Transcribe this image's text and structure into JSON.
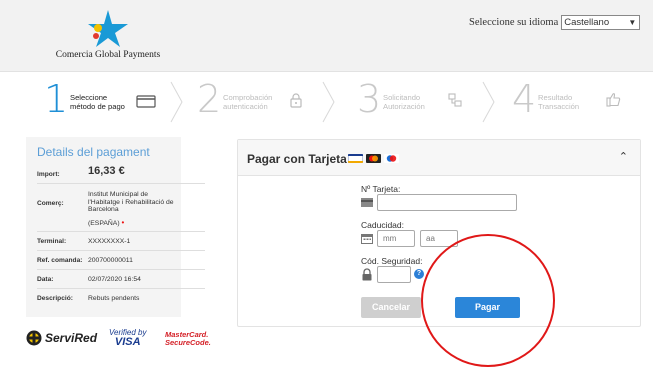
{
  "header": {
    "logo_text": "Comercia Global Payments",
    "language_label": "Seleccione su idioma",
    "language_value": "Castellano"
  },
  "steps": [
    {
      "number": "1",
      "line1": "Seleccione",
      "line2": "método de pago",
      "icon": "card-icon",
      "state": "active"
    },
    {
      "number": "2",
      "line1": "Comprobación",
      "line2": "autenticación",
      "icon": "lock-icon",
      "state": "inactive"
    },
    {
      "number": "3",
      "line1": "Solicitando",
      "line2": "Autorización",
      "icon": "network-icon",
      "state": "inactive"
    },
    {
      "number": "4",
      "line1": "Resultado",
      "line2": "Transacción",
      "icon": "thumbs-up-icon",
      "state": "inactive"
    }
  ],
  "details": {
    "title": "Details del pagament",
    "rows": [
      {
        "key": "Import:",
        "value": "16,33 €"
      },
      {
        "key": "Comerç:",
        "value": "Institut Municipal de l'Habitatge i Rehabilitació de Barcelona",
        "extra": "(ESPAÑA)"
      },
      {
        "key": "Terminal:",
        "value": "XXXXXXXX-1"
      },
      {
        "key": "Ref. comanda:",
        "value": "200700000011"
      },
      {
        "key": "Data:",
        "value": "02/07/2020  16:54"
      },
      {
        "key": "Descripció:",
        "value": "Rebuts pendents"
      }
    ]
  },
  "brands": {
    "servired": "ServiRed",
    "verified_1": "Verified by",
    "verified_2": "VISA",
    "mc_1": "MasterCard.",
    "mc_2": "SecureCode."
  },
  "payment": {
    "title": "Pagar con Tarjeta",
    "card_label": "Nº Tarjeta:",
    "card_value": "",
    "expiry_label": "Caducidad:",
    "month_placeholder": "mm",
    "year_placeholder": "aa",
    "cvv_label": "Cód. Seguridad:",
    "cvv_value": "",
    "help": "?",
    "cancel_label": "Cancelar",
    "pay_label": "Pagar",
    "collapse_icon": "chevron-up-icon"
  },
  "colors": {
    "accent": "#1f8fd6",
    "pay_button": "#2b86d9",
    "annotation_circle": "#e01818"
  }
}
